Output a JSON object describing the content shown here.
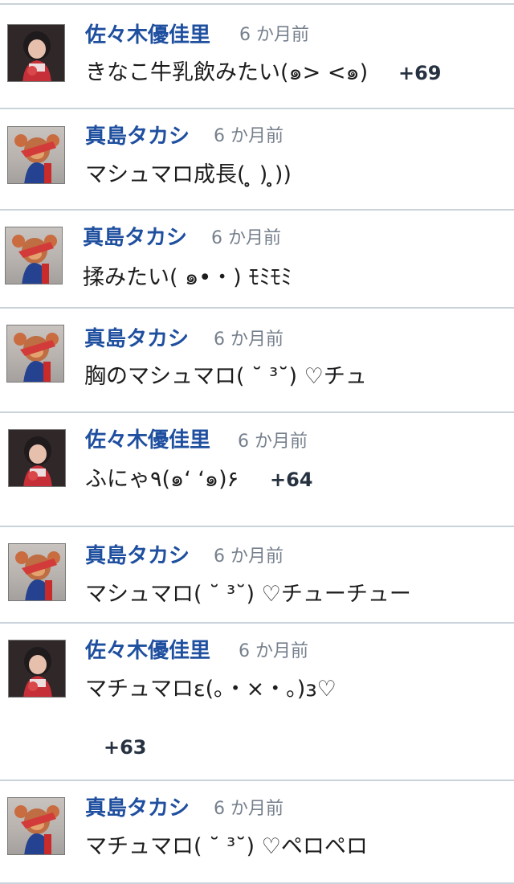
{
  "comments": [
    {
      "author": "佐々木優佳里",
      "time": "6 か月前",
      "text": "きなこ牛乳飲みたい(๑> <๑)",
      "reaction": "+69",
      "avatar": "person-avatar"
    },
    {
      "author": "真島タカシ",
      "time": "6 か月前",
      "text": "マシュマロ成長( ̥̥̥̥̥ ) ̥̥̥̥̥))",
      "reaction": "",
      "avatar": "mascot-avatar"
    },
    {
      "author": "真島タカシ",
      "time": "6 か月前",
      "text": "揉みたい( ๑•・) ﾓﾐﾓﾐ",
      "reaction": "",
      "avatar": "mascot-avatar"
    },
    {
      "author": "真島タカシ",
      "time": "6 か月前",
      "text": "胸のマシュマロ( ˘ ³˘) ♡チュ",
      "reaction": "",
      "avatar": "mascot-avatar"
    },
    {
      "author": "佐々木優佳里",
      "time": "6 か月前",
      "text": "ふにゃ٩(๑ʻ ʻ๑)۶",
      "reaction": "+64",
      "avatar": "person-avatar"
    },
    {
      "author": "真島タカシ",
      "time": "6 か月前",
      "text": "マシュマロ( ˘ ³˘) ♡チューチュー",
      "reaction": "",
      "avatar": "mascot-avatar"
    },
    {
      "author": "佐々木優佳里",
      "time": "6 か月前",
      "text": "マチュマロε(｡・×・｡)з♡",
      "reaction": "+63",
      "avatar": "person-avatar"
    },
    {
      "author": "真島タカシ",
      "time": "6 か月前",
      "text": "マチュマロ( ˘ ³˘) ♡ペロペロ",
      "reaction": "",
      "avatar": "mascot-avatar"
    }
  ]
}
